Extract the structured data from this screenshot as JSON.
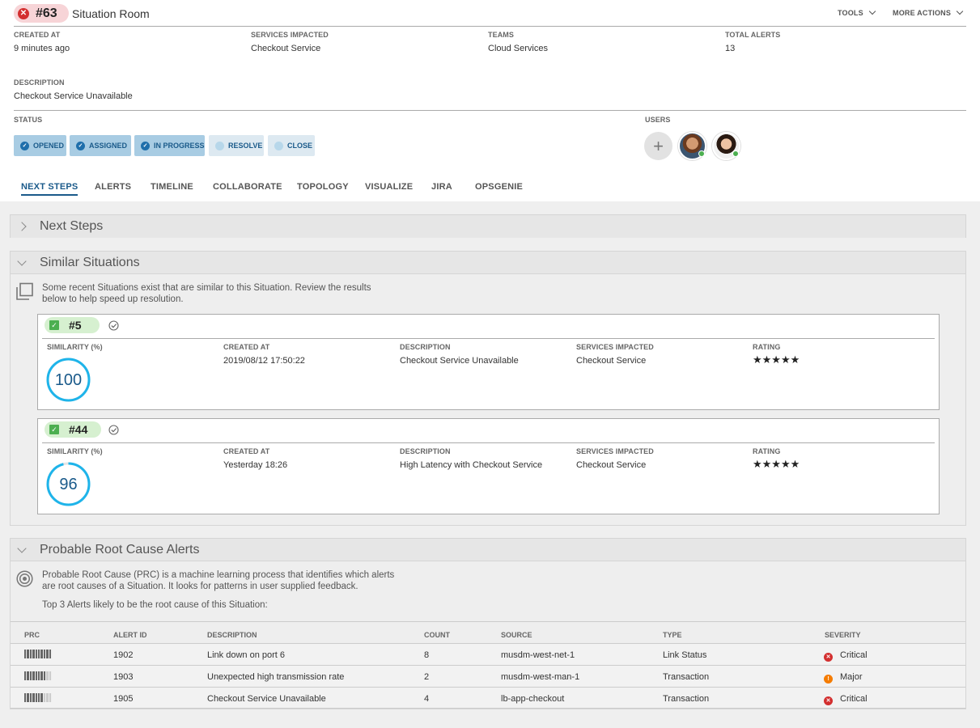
{
  "header": {
    "id": "#63",
    "title": "Situation Room",
    "tools": "TOOLS",
    "more_actions": "MORE ACTIONS"
  },
  "info": {
    "created_at_label": "CREATED AT",
    "created_at": "9 minutes ago",
    "services_label": "SERVICES IMPACTED",
    "services": "Checkout Service",
    "teams_label": "TEAMS",
    "teams": "Cloud Services",
    "total_alerts_label": "TOTAL ALERTS",
    "total_alerts": "13",
    "description_label": "DESCRIPTION",
    "description": "Checkout Service Unavailable"
  },
  "status": {
    "label": "STATUS",
    "users_label": "USERS",
    "buttons": [
      "OPENED",
      "ASSIGNED",
      "IN PROGRESS",
      "RESOLVE",
      "CLOSE"
    ]
  },
  "tabs": [
    "NEXT STEPS",
    "ALERTS",
    "TIMELINE",
    "COLLABORATE",
    "TOPOLOGY",
    "VISUALIZE",
    "JIRA",
    "OPSGENIE"
  ],
  "next_steps": {
    "title": "Next Steps"
  },
  "similar": {
    "title": "Similar Situations",
    "intro": "Some recent Situations exist that are similar to this Situation. Review the results below to help speed up resolution.",
    "labels": {
      "similarity": "SIMILARITY (%)",
      "created": "CREATED AT",
      "description": "DESCRIPTION",
      "services": "SERVICES IMPACTED",
      "rating": "RATING"
    },
    "cards": [
      {
        "id": "#5",
        "similarity": "100",
        "similarity_pct": 100,
        "created": "2019/08/12 17:50:22",
        "description": "Checkout Service Unavailable",
        "services": "Checkout Service",
        "rating": 5,
        "stars": "★★★★★"
      },
      {
        "id": "#44",
        "similarity": "96",
        "similarity_pct": 96,
        "created": "Yesterday 18:26",
        "description": "High Latency with Checkout Service",
        "services": "Checkout Service",
        "rating": 5,
        "stars": "★★★★★"
      }
    ]
  },
  "prc": {
    "title": "Probable Root Cause Alerts",
    "intro": "Probable Root Cause (PRC) is a machine learning process that identifies which alerts are root causes of a Situation. It looks for patterns in user supplied feedback.",
    "top3": "Top 3 Alerts likely to be the root cause of this Situation:",
    "columns": [
      "PRC",
      "ALERT ID",
      "DESCRIPTION",
      "COUNT",
      "SOURCE",
      "TYPE",
      "SEVERITY"
    ],
    "rows": [
      {
        "alert_id": "1902",
        "description": "Link down on port 6",
        "count": "8",
        "source": "musdm-west-net-1",
        "type": "Link Status",
        "severity": "Critical",
        "prc_level": 1.0
      },
      {
        "alert_id": "1903",
        "description": "Unexpected high transmission rate",
        "count": "2",
        "source": "musdm-west-man-1",
        "type": "Transaction",
        "severity": "Major",
        "prc_level": 0.8
      },
      {
        "alert_id": "1905",
        "description": "Checkout Service Unavailable",
        "count": "4",
        "source": "lb-app-checkout",
        "type": "Transaction",
        "severity": "Critical",
        "prc_level": 0.7
      }
    ]
  },
  "colors": {
    "accent": "#1a5a8a",
    "critical": "#d32f2f",
    "major": "#f57c00",
    "ring": "#1eb4ea",
    "online": "#4caf50"
  }
}
